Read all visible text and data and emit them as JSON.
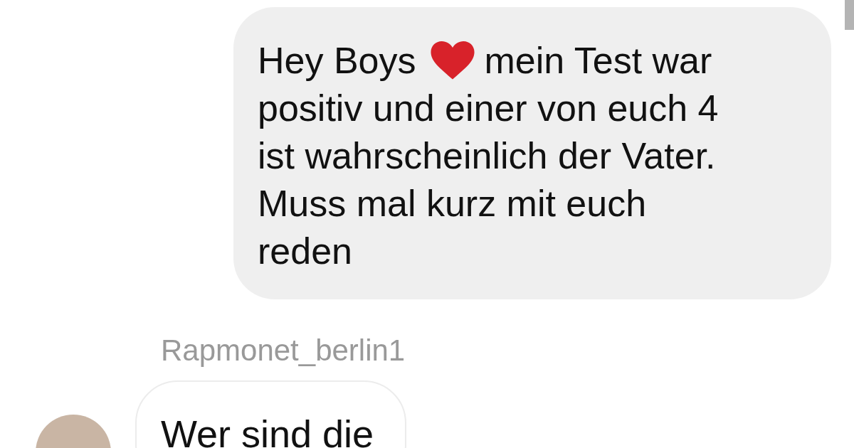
{
  "messages": [
    {
      "kind": "sent",
      "first_line_before_icon": "Hey Boys",
      "first_line_after_icon": "mein Test war",
      "lines": [
        "positiv und einer von euch 4",
        "ist wahrscheinlich der Vater.",
        "Muss mal kurz mit euch",
        "reden"
      ]
    },
    {
      "kind": "received",
      "sender": "Rapmonet_berlin1",
      "text": "Wer sind die"
    }
  ]
}
